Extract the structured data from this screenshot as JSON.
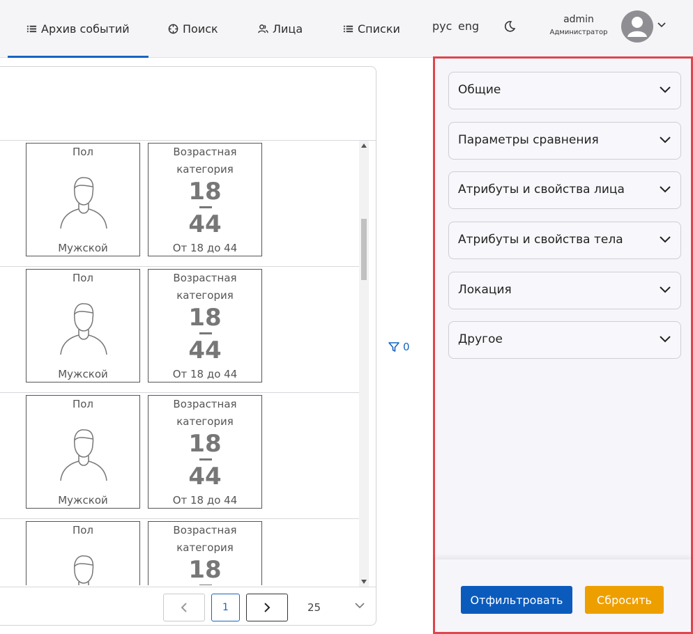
{
  "nav": {
    "archive": "Архив событий",
    "search": "Поиск",
    "faces": "Лица",
    "lists": "Списки",
    "lang_ru": "рус",
    "lang_en": "eng"
  },
  "user": {
    "name": "admin",
    "role": "Администратор"
  },
  "cards": {
    "gender_label": "Пол",
    "gender_value": "Мужской",
    "age_label_1": "Возрастная",
    "age_label_2": "категория",
    "age_from": "18",
    "age_to": "44",
    "age_text": "От 18 до 44"
  },
  "pager": {
    "current": "1",
    "page_size": "25"
  },
  "filter_count": "0",
  "filters": {
    "general": "Общие",
    "compare": "Параметры сравнения",
    "face_attrs": "Атрибуты и свойства лица",
    "body_attrs": "Атрибуты и свойства тела",
    "location": "Локация",
    "other": "Другое"
  },
  "buttons": {
    "apply": "Отфильтровать",
    "reset": "Сбросить"
  },
  "colors": {
    "accent": "#1565c0",
    "apply_button": "#0b5bbd",
    "reset_button": "#ee9f00",
    "highlight_border": "#e0454d"
  }
}
